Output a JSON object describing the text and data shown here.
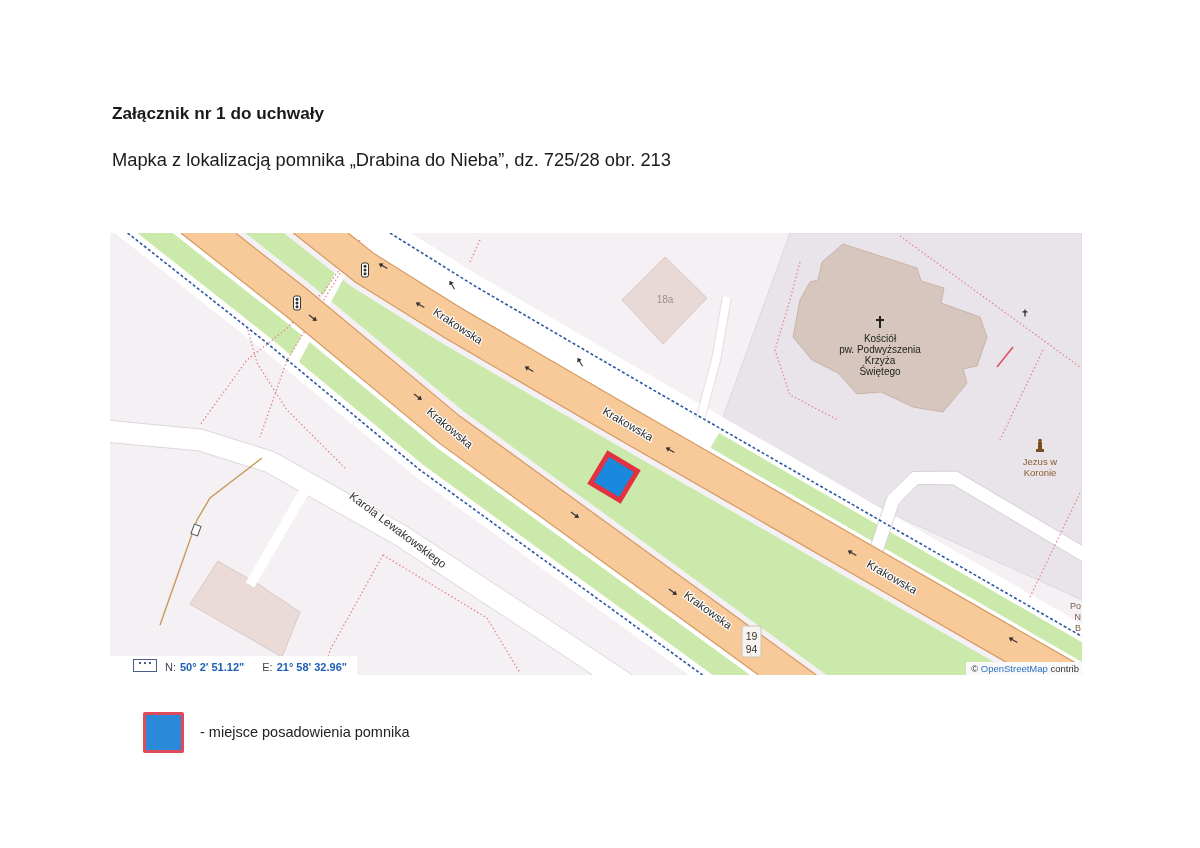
{
  "document": {
    "title": "Załącznik nr 1 do uchwały",
    "subtitle": "Mapka z lokalizacją pomnika „Drabina do Nieba”, dz. 725/28 obr. 213"
  },
  "map": {
    "street_labels": [
      "Krakowska",
      "Krakowska",
      "Krakowska",
      "Krakowska",
      "Krakowska",
      "Karola Lewakowskiego"
    ],
    "building_number": "18a",
    "church_label": [
      "Kościół",
      "pw. Podwyższenia",
      "Krzyża",
      "Świętego"
    ],
    "monument_label": [
      "Jezus w",
      "Koronie"
    ],
    "route_number": [
      "19",
      "94"
    ],
    "edge_label": [
      "Po",
      "N",
      "B"
    ],
    "coordinates": [
      {
        "label": "N:",
        "value": "50° 2' 51.12\""
      },
      {
        "label": "E:",
        "value": "21° 58' 32.96\""
      }
    ],
    "attribution": {
      "symbol": "©",
      "link": "OpenStreetMap",
      "text": "contrib"
    }
  },
  "legend": [
    {
      "text": "- miejsce posadowienia pomnika"
    }
  ]
}
